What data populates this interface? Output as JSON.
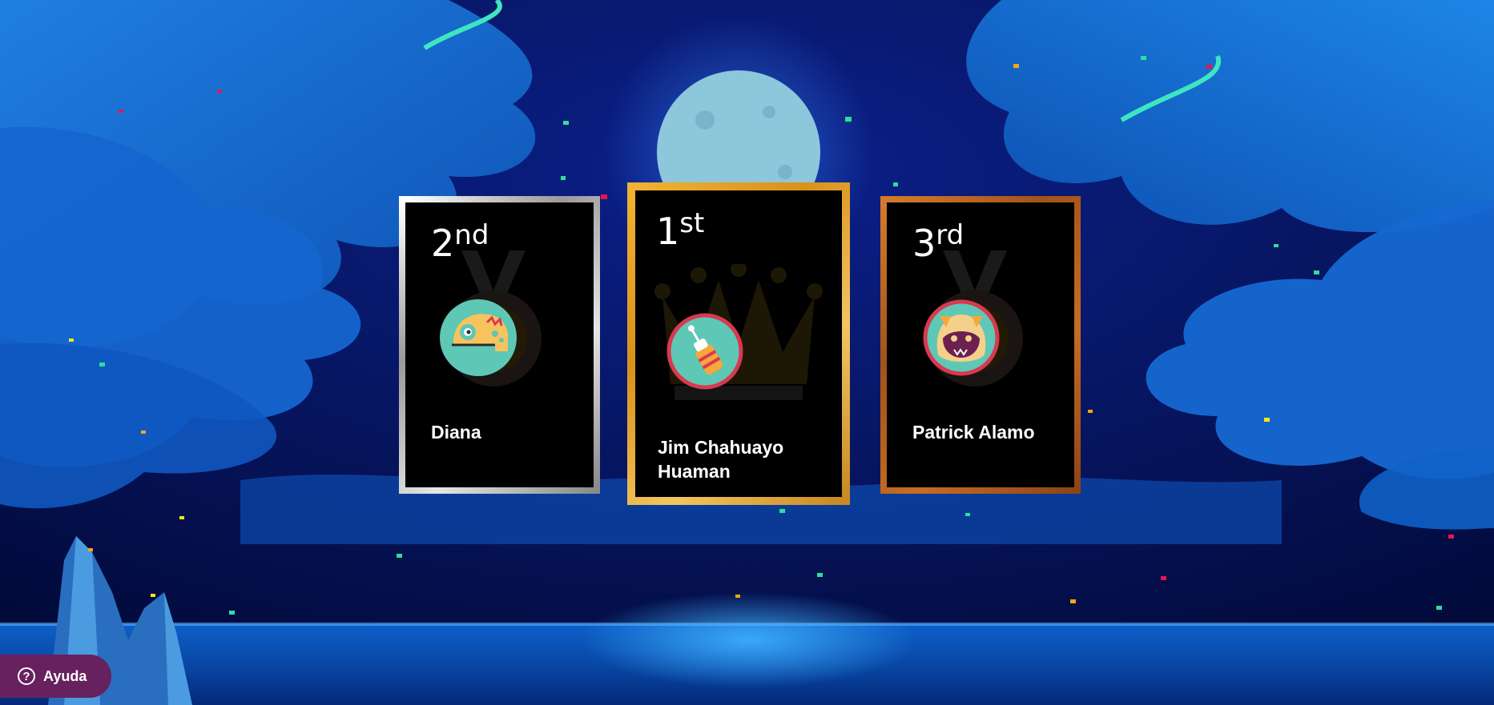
{
  "podium": [
    {
      "position": 2,
      "rank_number": "2",
      "rank_suffix": "nd",
      "name": "Diana",
      "frame": "silver",
      "avatar_icon": "chameleon-avatar-icon",
      "emblem_icon": "medal-icon"
    },
    {
      "position": 1,
      "rank_number": "1",
      "rank_suffix": "st",
      "name": "Jim Chahuayo Huaman",
      "frame": "gold",
      "avatar_icon": "rocket-avatar-icon",
      "emblem_icon": "crown-icon"
    },
    {
      "position": 3,
      "rank_number": "3",
      "rank_suffix": "rd",
      "name": "Patrick Alamo",
      "frame": "bronze",
      "avatar_icon": "monster-avatar-icon",
      "emblem_icon": "medal-icon"
    }
  ],
  "help_button": {
    "label": "Ayuda",
    "icon": "question-circle-icon"
  },
  "colors": {
    "gold": "#e9a21f",
    "silver": "#c9c9c9",
    "bronze": "#b5601d",
    "help_bg": "#67215f",
    "avatar_teal": "#5ec7b5",
    "avatar_ring": "#d9394f"
  },
  "background": {
    "scene": "night sky with full moon, clouds, sea and confetti"
  }
}
